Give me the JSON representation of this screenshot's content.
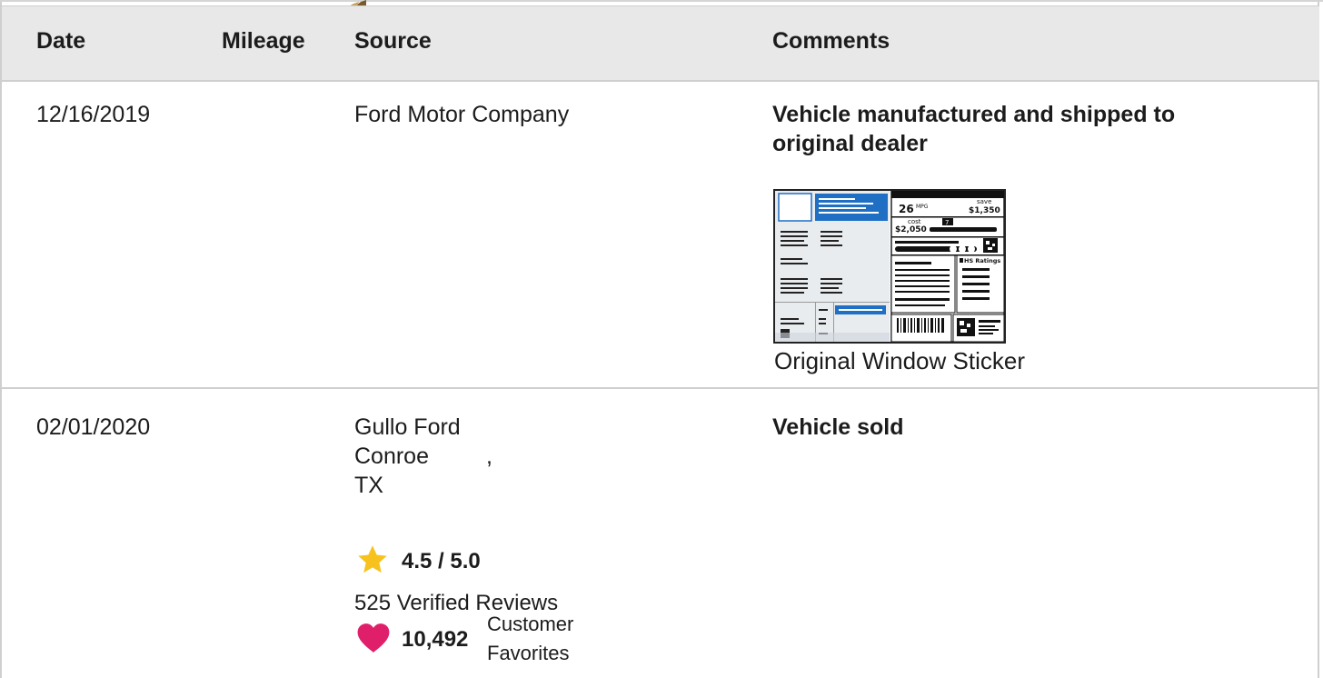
{
  "table": {
    "headers": {
      "date": "Date",
      "mileage": "Mileage",
      "source": "Source",
      "comments": "Comments"
    },
    "rows": [
      {
        "date": "12/16/2019",
        "mileage": "",
        "source": "Ford Motor Company",
        "comment_line1": "Vehicle manufactured and shipped to",
        "comment_line2": "original dealer",
        "sticker_caption": "Original Window Sticker"
      },
      {
        "date": "02/01/2020",
        "mileage": "",
        "source_name": "Gullo Ford",
        "source_city": "Conroe",
        "source_comma": ",",
        "source_state": "TX",
        "comment": "Vehicle sold",
        "rating": "4.5 / 5.0",
        "reviews": "525 Verified Reviews",
        "favorites_count": "10,492",
        "favorites_label_1": "Customer",
        "favorites_label_2": "Favorites"
      }
    ]
  },
  "sticker": {
    "mpg": "26",
    "mpg_unit": "MPG",
    "save_label": "save",
    "save_amount": "$1,350",
    "cost_label": "cost",
    "cost_amount": "$2,050",
    "rating_number": "7",
    "ratings_title": "HS Ratings"
  },
  "colors": {
    "header_bg": "#e8e8e8",
    "border": "#cfcfcf",
    "star": "#f7c21d",
    "heart": "#e01f6b",
    "sticker_blue": "#1f6fc4"
  },
  "icons": {
    "star": "star-icon",
    "heart": "heart-icon"
  }
}
